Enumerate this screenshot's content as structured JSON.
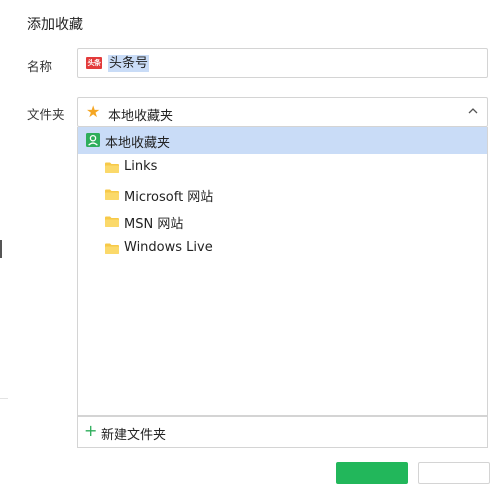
{
  "dialog": {
    "title": "添加收藏"
  },
  "name_field": {
    "label": "名称",
    "site_icon_text": "头条",
    "value": "头条号"
  },
  "folder_field": {
    "label": "文件夹",
    "selected": "本地收藏夹",
    "icons": {
      "selected": "star-icon",
      "toggle": "chevron-up-icon"
    }
  },
  "tree": {
    "root": {
      "label": "本地收藏夹",
      "icon": "user-icon",
      "selected": true
    },
    "items": [
      {
        "label": "Links",
        "icon": "folder-icon"
      },
      {
        "label": "Microsoft 网站",
        "icon": "folder-icon"
      },
      {
        "label": "MSN 网站",
        "icon": "folder-icon"
      },
      {
        "label": "Windows Live",
        "icon": "folder-icon"
      }
    ]
  },
  "footer": {
    "new_folder_label": "新建文件夹",
    "icon": "plus-icon"
  },
  "colors": {
    "accent_green": "#22b75b",
    "selection_blue": "#c9dcf7",
    "star_orange": "#f5a623",
    "folder_yellow": "#f7c948",
    "badge_red": "#e33b3b"
  }
}
